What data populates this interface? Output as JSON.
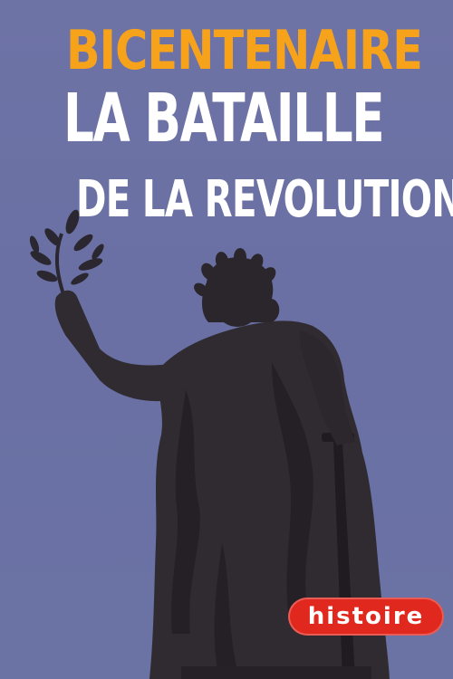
{
  "poster": {
    "title_line1": "BICENTENAIRE",
    "title_line2": "LA BATAILLE",
    "title_line3": "DE LA REVOLUTION",
    "channel_logo": "histoire",
    "colors": {
      "sky": "#6c72a5",
      "title_accent": "#f7a21b",
      "title_main": "#ffffff",
      "statue": "#2e2a2e",
      "logo_bg": "#e0281e"
    }
  }
}
